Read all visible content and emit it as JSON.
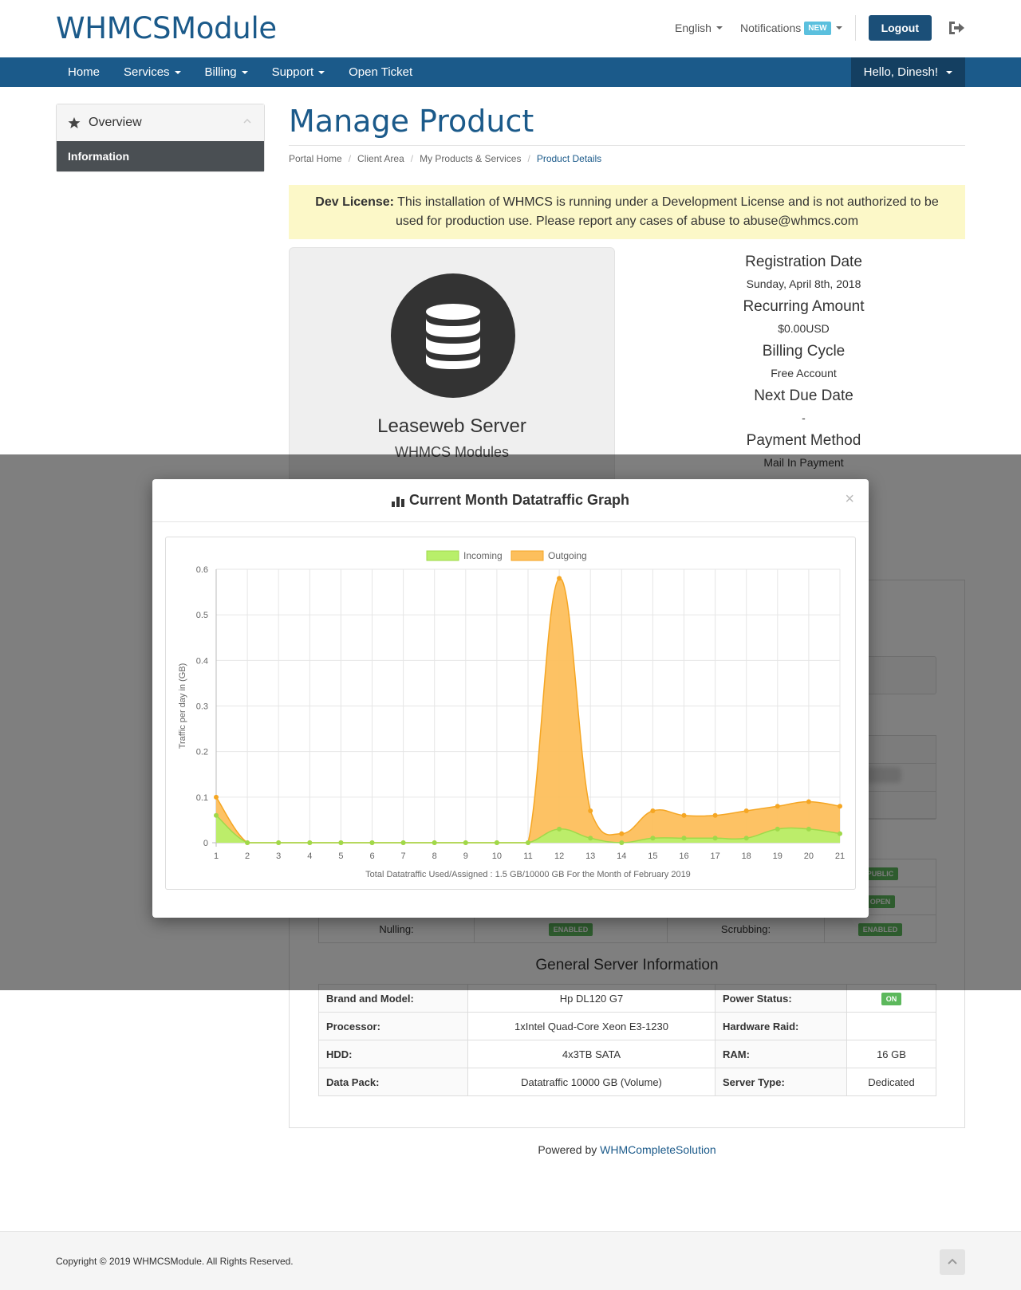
{
  "header": {
    "logo": "WHMCSModule",
    "language": "English",
    "notifications": "Notifications",
    "new_badge": "NEW",
    "logout": "Logout"
  },
  "nav": {
    "items": [
      "Home",
      "Services",
      "Billing",
      "Support",
      "Open Ticket"
    ],
    "user": "Hello, Dinesh!"
  },
  "sidebar": {
    "title": "Overview",
    "items": [
      "Information"
    ]
  },
  "main": {
    "title": "Manage Product",
    "breadcrumb": [
      "Portal Home",
      "Client Area",
      "My Products & Services",
      "Product Details"
    ],
    "alert_bold": "Dev License:",
    "alert_text": "This installation of WHMCS is running under a Development License and is not authorized to be used for production use. Please report any cases of abuse to abuse@whmcs.com"
  },
  "product": {
    "name": "Leaseweb Server",
    "group": "WHMCS Modules"
  },
  "registration": {
    "reg_label": "Registration Date",
    "reg_value": "Sunday, April 8th, 2018",
    "recurring_label": "Recurring Amount",
    "recurring_value": "$0.00USD",
    "cycle_label": "Billing Cycle",
    "cycle_value": "Free Account",
    "due_label": "Next Due Date",
    "due_value": "-",
    "payment_label": "Payment Method",
    "payment_value": "Mail In Payment"
  },
  "network": {
    "tag_public": "PUBLIC",
    "tag_open": "OPEN",
    "nulling_label": "Nulling:",
    "nulling_value": "ENABLED",
    "scrubbing_label": "Scrubbing:",
    "scrubbing_value": "ENABLED"
  },
  "server_info": {
    "title": "General Server Information",
    "rows": [
      {
        "k1": "Brand and Model:",
        "v1": "Hp DL120 G7",
        "k2": "Power Status:",
        "v2": "ON"
      },
      {
        "k1": "Processor:",
        "v1": "1xIntel Quad-Core Xeon E3-1230",
        "k2": "Hardware Raid:",
        "v2": ""
      },
      {
        "k1": "HDD:",
        "v1": "4x3TB SATA",
        "k2": "RAM:",
        "v2": "16 GB"
      },
      {
        "k1": "Data Pack:",
        "v1": "Datatraffic 10000 GB (Volume)",
        "k2": "Server Type:",
        "v2": "Dedicated"
      }
    ]
  },
  "footer": {
    "powered_prefix": "Powered by",
    "powered_link": "WHMCompleteSolution",
    "copyright": "Copyright © 2019 WHMCSModule. All Rights Reserved."
  },
  "modal": {
    "title": "Current Month Datatraffic Graph",
    "close": "×"
  },
  "colors": {
    "brand": "#1b5a8a",
    "incoming": "#b8ef6a",
    "outgoing": "#fdbf5c"
  },
  "chart_data": {
    "type": "area",
    "ylabel": "Traffic per day in (GB)",
    "xlabel": "Total Datatraffic Used/Assigned : 1.5 GB/10000 GB For the Month of February 2019",
    "x": [
      1,
      2,
      3,
      4,
      5,
      6,
      7,
      8,
      9,
      10,
      11,
      12,
      13,
      14,
      15,
      16,
      17,
      18,
      19,
      20,
      21
    ],
    "ylim": [
      0,
      0.6
    ],
    "yticks": [
      0,
      0.1,
      0.2,
      0.3,
      0.4,
      0.5,
      0.6
    ],
    "legend": "top",
    "grid": true,
    "series": [
      {
        "name": "Incoming",
        "color": "#b8ef6a",
        "values": [
          0.06,
          0,
          0,
          0,
          0,
          0,
          0,
          0,
          0,
          0,
          0,
          0.03,
          0.01,
          0,
          0.01,
          0.01,
          0.01,
          0.01,
          0.03,
          0.03,
          0.02
        ]
      },
      {
        "name": "Outgoing",
        "color": "#fdbf5c",
        "values": [
          0.1,
          0,
          0,
          0,
          0,
          0,
          0,
          0,
          0,
          0,
          0,
          0.58,
          0.07,
          0.02,
          0.07,
          0.06,
          0.06,
          0.07,
          0.08,
          0.09,
          0.08
        ]
      }
    ]
  }
}
